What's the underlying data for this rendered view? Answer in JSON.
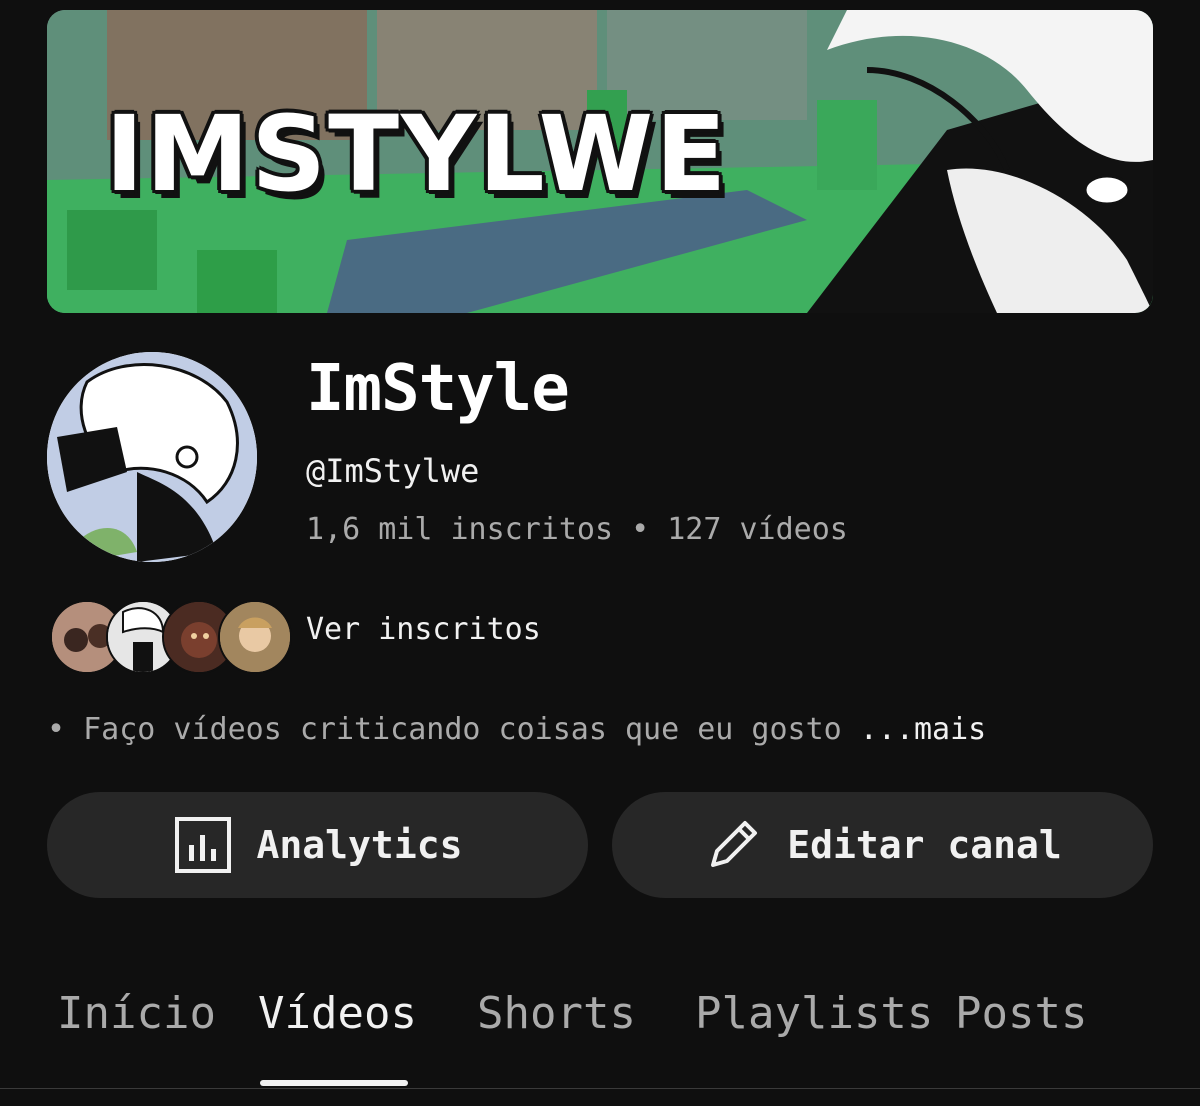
{
  "banner": {
    "title": "IMSTYLWE"
  },
  "channel": {
    "name": "ImStyle",
    "handle": "@ImStylwe",
    "stats": "1,6 mil inscritos • 127 vídeos"
  },
  "subscribers": {
    "link_label": "Ver inscritos"
  },
  "description": {
    "text": "• Faço vídeos criticando coisas que eu gosto ",
    "more_label": "...mais"
  },
  "buttons": {
    "analytics_label": "Analytics",
    "edit_label": "Editar canal"
  },
  "tabs": [
    {
      "label": "Início"
    },
    {
      "label": "Vídeos"
    },
    {
      "label": "Shorts"
    },
    {
      "label": "Playlists"
    },
    {
      "label": "Posts"
    }
  ],
  "active_tab": "Vídeos",
  "colors": {
    "background": "#0f0f0f",
    "button_bg": "#272727",
    "text_primary": "#f1f1f1",
    "text_secondary": "#aaaaaa"
  }
}
